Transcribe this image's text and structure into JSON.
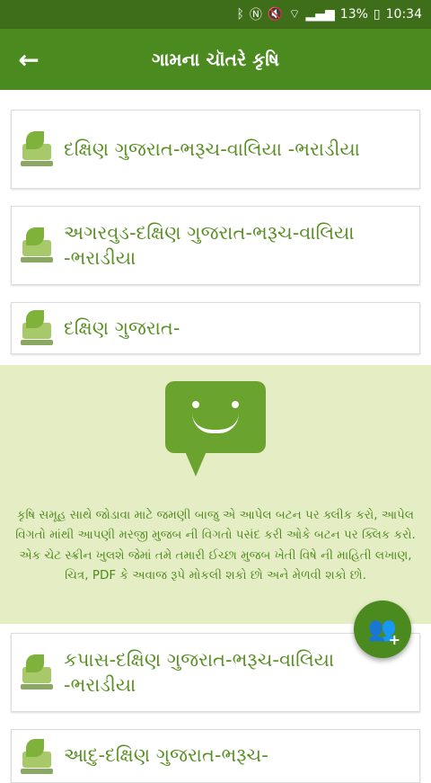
{
  "statusbar": {
    "battery_percent": "13%",
    "time": "10:34",
    "icons": [
      "bluetooth-icon",
      "nfc-icon",
      "mute-icon",
      "wifi-icon",
      "signal-icon",
      "battery-icon"
    ]
  },
  "appbar": {
    "back_icon": "arrow-left-icon",
    "title": "ગામના ચૉતરે કૃષિ"
  },
  "list": {
    "items": [
      {
        "label": "દક્ષિણ ગુજરાત-ભરૂચ-વાલિયા -ભરાડીયા"
      },
      {
        "label": "અગરવુડ-દક્ષિણ ગુજરાત-ભરૂચ-વાલિયા -ભરાડીયા"
      },
      {
        "label": "દક્ષિણ ગુજરાત-"
      },
      {
        "label": "કપાસ-દક્ષિણ ગુજરાત-ભરૂચ-વાલિયા -ભરાડીયા"
      },
      {
        "label": "આદુ-દક્ષિણ ગુજરાત-ભરૂચ-"
      }
    ]
  },
  "info_panel": {
    "icon": "chat-smile-icon",
    "text": "કૃષિ સમૂહ સાથે જોડાવા માટે જમણી બાજુ એ આપેલ બટન પર ક્લીક કરો, આપેલ વિગતો માંથી આપણી મરજી મુજબ ની વિગતો પસંદ કરી ઓકે બટન પર ક્લિક કરો. એક ચેટ સ્ક્રીન ખુલશે જેમાં તમે તમારી ઈચ્છા મુજબ ખેતી વિષે ની માહિતી લખાણ, ચિત્ર, PDF કે અવાજ રૂપે મોકલી શકો છો અને મેળવી શકો છો."
  },
  "fab": {
    "icon": "add-group-icon"
  },
  "colors": {
    "statusbar": "#3f6e1a",
    "appbar": "#4b8a1f",
    "accent_text": "#5a8f26",
    "info_bg": "#e4edc4"
  }
}
